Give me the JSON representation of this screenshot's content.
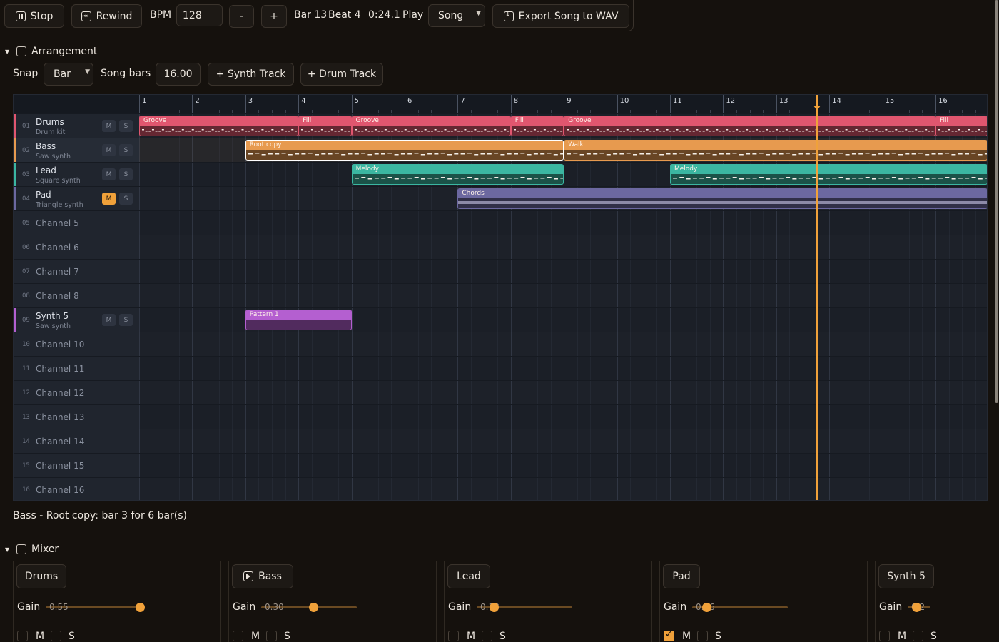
{
  "toolbar": {
    "stop": "Stop",
    "rewind": "Rewind",
    "bpm_label": "BPM",
    "bpm_value": "128",
    "minus": "-",
    "plus": "+",
    "bar": "Bar 13",
    "beat": "Beat 4",
    "time": "0:24.1",
    "play_label": "Play",
    "mode": "Song",
    "export": "Export Song to WAV"
  },
  "arrangement": {
    "title": "Arrangement",
    "snap_label": "Snap",
    "snap_value": "Bar",
    "song_bars_label": "Song bars",
    "song_bars_value": "16.00",
    "add_synth": "+ Synth Track",
    "add_drum": "+ Drum Track",
    "bar_numbers": [
      "1",
      "2",
      "3",
      "4",
      "5",
      "6",
      "7",
      "8",
      "9",
      "10",
      "11",
      "12",
      "13",
      "14",
      "15",
      "16"
    ],
    "playhead_bar": 13.75,
    "tracks": [
      {
        "num": "01",
        "name": "Drums",
        "sub": "Drum kit",
        "color": "#e0566f",
        "muted": false,
        "clips": [
          {
            "label": "Groove",
            "start": 1,
            "len": 3
          },
          {
            "label": "Fill",
            "start": 4,
            "len": 1
          },
          {
            "label": "Groove",
            "start": 5,
            "len": 3
          },
          {
            "label": "Fill",
            "start": 8,
            "len": 1
          },
          {
            "label": "Groove",
            "start": 9,
            "len": 7
          },
          {
            "label": "Fill",
            "start": 16,
            "len": 1
          }
        ]
      },
      {
        "num": "02",
        "name": "Bass",
        "sub": "Saw synth",
        "color": "#e79a4f",
        "muted": false,
        "clips": [
          {
            "label": "Root copy",
            "start": 3,
            "len": 6,
            "selected": true
          },
          {
            "label": "Walk",
            "start": 9,
            "len": 8
          }
        ]
      },
      {
        "num": "03",
        "name": "Lead",
        "sub": "Square synth",
        "color": "#3bb6a1",
        "muted": false,
        "clips": [
          {
            "label": "Melody",
            "start": 5,
            "len": 4
          },
          {
            "label": "Melody",
            "start": 11,
            "len": 6
          }
        ]
      },
      {
        "num": "04",
        "name": "Pad",
        "sub": "Triangle synth",
        "color": "#6c68a0",
        "muted": true,
        "clips": [
          {
            "label": "Chords",
            "start": 7,
            "len": 10
          }
        ]
      },
      {
        "num": "05",
        "name": "Channel 5"
      },
      {
        "num": "06",
        "name": "Channel 6"
      },
      {
        "num": "07",
        "name": "Channel 7"
      },
      {
        "num": "08",
        "name": "Channel 8"
      },
      {
        "num": "09",
        "name": "Synth 5",
        "sub": "Saw synth",
        "color": "#b45fd0",
        "muted": false,
        "clips": [
          {
            "label": "Pattern 1",
            "start": 3,
            "len": 2
          }
        ]
      },
      {
        "num": "10",
        "name": "Channel 10"
      },
      {
        "num": "11",
        "name": "Channel 11"
      },
      {
        "num": "12",
        "name": "Channel 12"
      },
      {
        "num": "13",
        "name": "Channel 13"
      },
      {
        "num": "14",
        "name": "Channel 14"
      },
      {
        "num": "15",
        "name": "Channel 15"
      },
      {
        "num": "16",
        "name": "Channel 16"
      }
    ],
    "mute_label": "M",
    "solo_label": "S"
  },
  "status": "Bass - Root copy: bar 3 for 6 bar(s)",
  "mixer": {
    "title": "Mixer",
    "gain_label": "Gain",
    "m_label": "M",
    "s_label": "S",
    "strips": [
      {
        "name": "Drums",
        "gain": "0.55",
        "gain_value": 0.55,
        "muted": false,
        "play_icon": false
      },
      {
        "name": "Bass",
        "gain": "0.30",
        "gain_value": 0.3,
        "muted": false,
        "play_icon": true
      },
      {
        "name": "Lead",
        "gain": "0.18",
        "gain_value": 0.18,
        "muted": false,
        "play_icon": false
      },
      {
        "name": "Pad",
        "gain": "0.16",
        "gain_value": 0.16,
        "muted": true,
        "play_icon": false
      },
      {
        "name": "Synth 5",
        "gain": "0.2",
        "gain_value": 0.2,
        "muted": false,
        "play_icon": false
      }
    ]
  },
  "colors": {
    "accent": "#f0a13a"
  }
}
